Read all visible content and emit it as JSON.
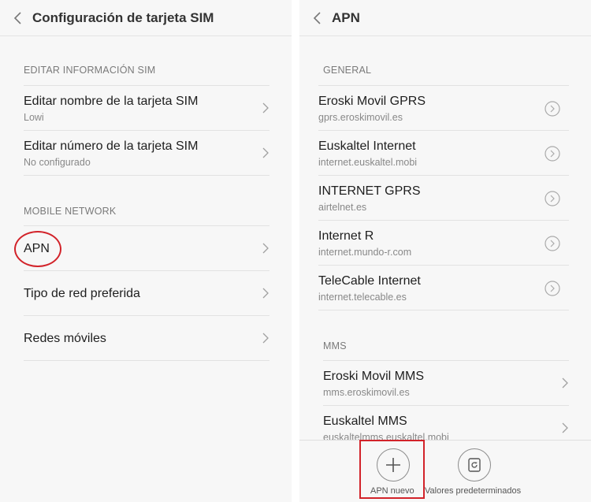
{
  "left": {
    "title": "Configuración de tarjeta SIM",
    "sections": {
      "sim_info": "EDITAR INFORMACIÓN SIM",
      "mobile_network": "MOBILE NETWORK"
    },
    "rows": [
      {
        "title": "Editar nombre de la tarjeta SIM",
        "subtitle": "Lowi"
      },
      {
        "title": "Editar número de la tarjeta SIM",
        "subtitle": "No configurado"
      },
      {
        "title": "APN"
      },
      {
        "title": "Tipo de red preferida"
      },
      {
        "title": "Redes móviles"
      }
    ]
  },
  "right": {
    "title": "APN",
    "sections": {
      "general": "GENERAL",
      "mms": "MMS"
    },
    "general": [
      {
        "title": "Eroski Movil GPRS",
        "subtitle": "gprs.eroskimovil.es"
      },
      {
        "title": "Euskaltel Internet",
        "subtitle": "internet.euskaltel.mobi"
      },
      {
        "title": "INTERNET GPRS",
        "subtitle": "airtelnet.es"
      },
      {
        "title": "Internet R",
        "subtitle": "internet.mundo-r.com"
      },
      {
        "title": "TeleCable Internet",
        "subtitle": "internet.telecable.es"
      }
    ],
    "mms": [
      {
        "title": "Eroski Movil MMS",
        "subtitle": "mms.eroskimovil.es"
      },
      {
        "title": "Euskaltel MMS",
        "subtitle": "euskaltelmms.euskaltel.mobi"
      }
    ],
    "buttons": {
      "new_apn": "APN nuevo",
      "reset": "Valores predeterminados"
    }
  },
  "icons": {
    "back": "chevron-left-icon",
    "row_arrow": "chevron-right-icon",
    "detail": "circle-chevron-icon",
    "add": "plus-icon",
    "reset": "reset-icon"
  },
  "annotation_color": "#d2232a"
}
